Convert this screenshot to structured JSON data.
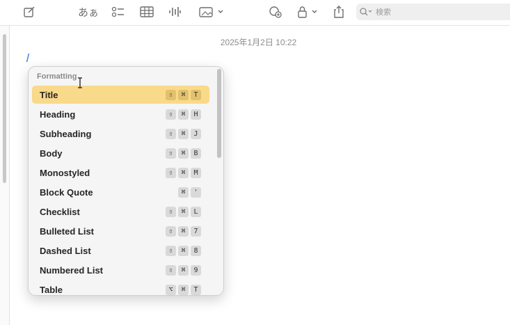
{
  "toolbar": {
    "text_style_label": "あぁ",
    "search_placeholder": "検索",
    "icons": [
      "compose-icon",
      "text-style-icon",
      "checklist-icon",
      "table-icon",
      "audio-icon",
      "media-icon",
      "collaborate-icon",
      "lock-icon",
      "share-icon",
      "search-icon"
    ]
  },
  "note": {
    "date": "2025年1月2日 10:22"
  },
  "menu": {
    "header": "Formatting",
    "items": [
      {
        "label": "Title",
        "keys": [
          "⇧",
          "⌘",
          "T"
        ]
      },
      {
        "label": "Heading",
        "keys": [
          "⇧",
          "⌘",
          "H"
        ]
      },
      {
        "label": "Subheading",
        "keys": [
          "⇧",
          "⌘",
          "J"
        ]
      },
      {
        "label": "Body",
        "keys": [
          "⇧",
          "⌘",
          "B"
        ]
      },
      {
        "label": "Monostyled",
        "keys": [
          "⇧",
          "⌘",
          "M"
        ]
      },
      {
        "label": "Block Quote",
        "keys": [
          "⌘",
          "'"
        ]
      },
      {
        "label": "Checklist",
        "keys": [
          "⇧",
          "⌘",
          "L"
        ]
      },
      {
        "label": "Bulleted List",
        "keys": [
          "⇧",
          "⌘",
          "7"
        ]
      },
      {
        "label": "Dashed List",
        "keys": [
          "⇧",
          "⌘",
          "8"
        ]
      },
      {
        "label": "Numbered List",
        "keys": [
          "⇧",
          "⌘",
          "9"
        ]
      },
      {
        "label": "Table",
        "keys": [
          "⌥",
          "⌘",
          "T"
        ]
      }
    ],
    "selected_index": 0
  },
  "colors": {
    "selection": "#f9d98a",
    "caret": "#4a90d9"
  }
}
